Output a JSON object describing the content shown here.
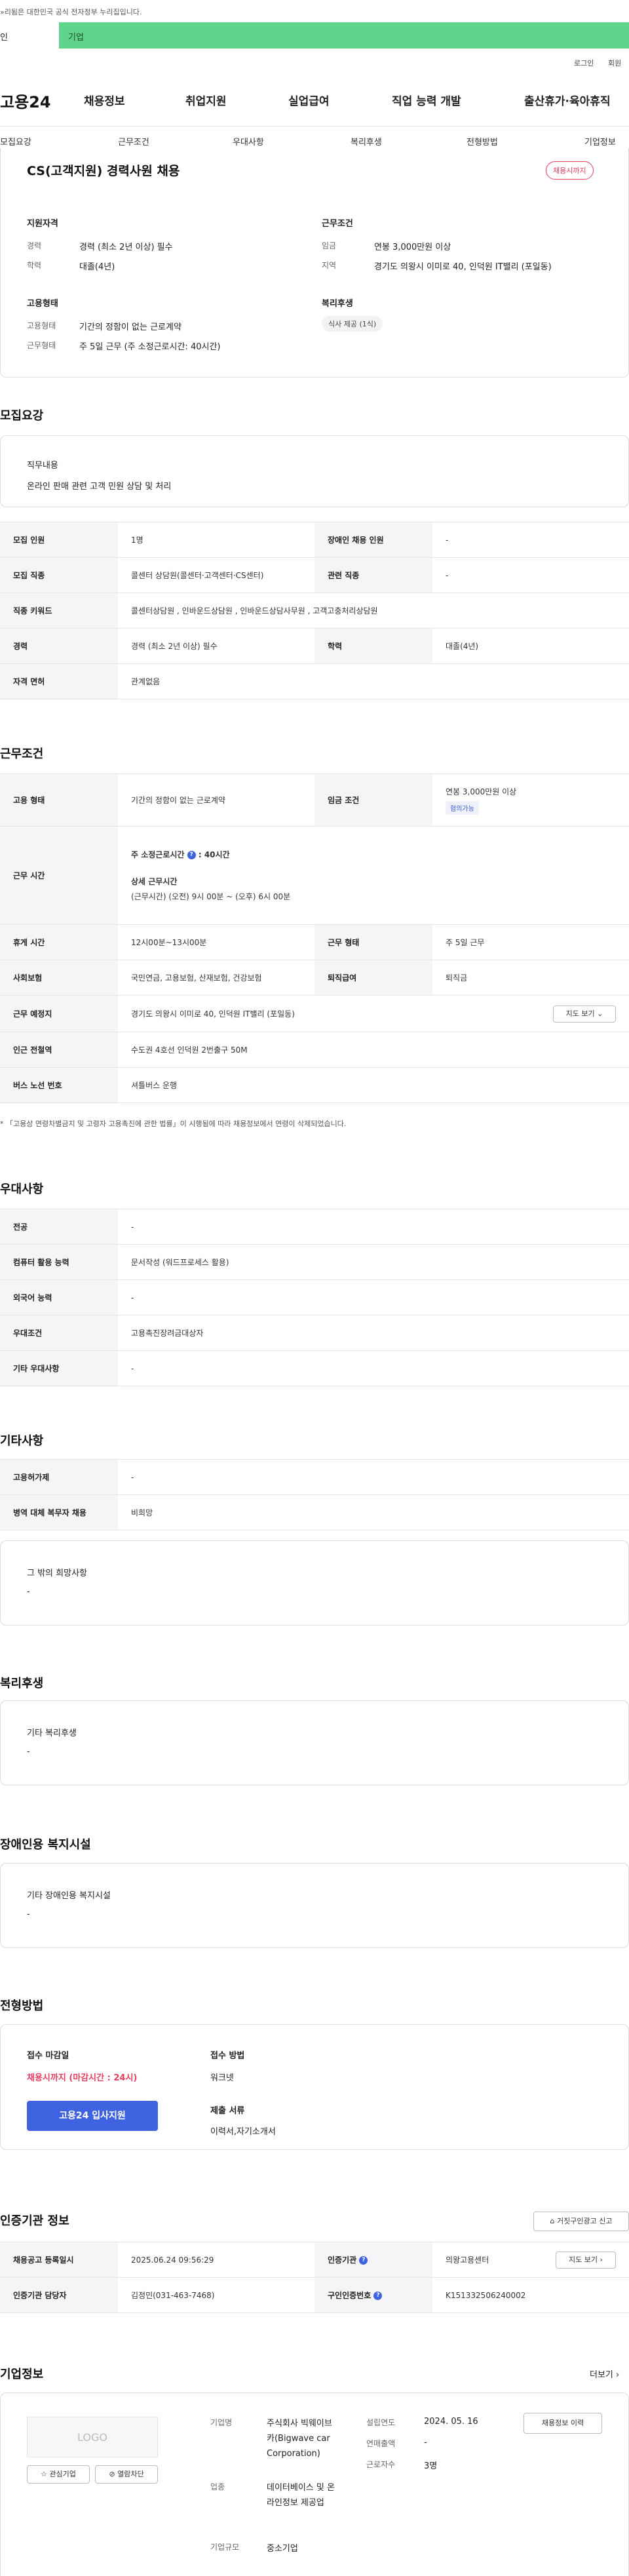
{
  "top_note": "»리됨은 대한민국 공식 전자정부 누리집입니다.",
  "top_tabs": {
    "left": "인",
    "right": "기업"
  },
  "util": {
    "login": "로그인",
    "join": "회원"
  },
  "gnb": {
    "logo": "고용24",
    "items": [
      "채용정보",
      "취업지원",
      "실업급여",
      "직업 능력 개발",
      "출산휴가·육아휴직"
    ]
  },
  "lnb": [
    "모집요강",
    "근무조건",
    "우대사항",
    "복리후생",
    "전형방법",
    "기업정보"
  ],
  "summary": {
    "title": "CS(고객지원) 경력사원 채용",
    "badge": "채용시까지",
    "qual": {
      "heading": "지원자격",
      "career_label": "경력",
      "career_value": "경력 (최소 2년 이상) 필수",
      "edu_label": "학력",
      "edu_value": "대졸(4년)"
    },
    "emp": {
      "heading": "고용형태",
      "type_label": "고용형태",
      "type_value": "기간의 정함이 없는 근로계약",
      "form_label": "근무형태",
      "form_value": "주 5일 근무 (주 소정근로시간: 40시간)"
    },
    "cond": {
      "heading": "근무조건",
      "wage_label": "임금",
      "wage_value": "연봉 3,000만원 이상",
      "loc_label": "지역",
      "loc_value": "경기도 의왕시 이미로 40, 인덕원 IT밸리 (포일동)"
    },
    "welfare": {
      "heading": "복리후생",
      "chip": "식사 제공 (1식)"
    }
  },
  "recruit": {
    "title": "모집요강",
    "duty_label": "직무내용",
    "duty_value": "온라인 판매 관련 고객 민원 상담 및 처리",
    "rows": {
      "count_label": "모집 인원",
      "count_value": "1명",
      "dis_label": "장애인 채용 인원",
      "dis_value": "-",
      "job_label": "모집 직종",
      "job_value": "콜센터 상담원(콜센터·고객센터·CS센터)",
      "rel_label": "관련 직종",
      "rel_value": "-",
      "kw_label": "직종 키워드",
      "kw_value": "콜센터상담원 , 인바운드상담원 , 인바운드상담사무원 , 고객고충처리상담원",
      "car_label": "경력",
      "car_value": "경력 (최소 2년 이상) 필수",
      "edu_label": "학력",
      "edu_value": "대졸(4년)",
      "lic_label": "자격 면허",
      "lic_value": "관계없음"
    }
  },
  "work": {
    "title": "근무조건",
    "type_label": "고용 형태",
    "type_value": "기간의 정함이 없는 근로계약",
    "wage_label": "임금 조건",
    "wage_value": "연봉 3,000만원 이상",
    "wage_chip": "협의가능",
    "hours_label": "근무 시간",
    "hours_week": "주 소정근로시간",
    "hours_week_value": "40시간",
    "hours_detail_label": "상세 근무시간",
    "hours_detail": "(근무시간) (오전) 9시 00분 ~ (오후) 6시 00분",
    "rest_label": "휴게 시간",
    "rest_value": "12시00분~13시00분",
    "form_label": "근무 형태",
    "form_value": "주 5일 근무",
    "ins_label": "사회보험",
    "ins_value": "국민연금, 고용보험, 산재보험, 건강보험",
    "ret_label": "퇴직급여",
    "ret_value": "퇴직금",
    "place_label": "근무 예정지",
    "place_value": "경기도 의왕시 이미로 40, 인덕원 IT밸리 (포일동)",
    "map_btn": "지도 보기",
    "sub_label": "인근 전철역",
    "sub_value": "수도권 4호선 인덕원 2번출구 50M",
    "bus_label": "버스 노선 번호",
    "bus_value": "셔틀버스 운행",
    "note": "* 「고용상 연령차별금지 및 고령자 고용촉진에 관한 법률」이 시행됨에 따라 채용정보에서 연령이 삭제되었습니다."
  },
  "pref": {
    "title": "우대사항",
    "major_label": "전공",
    "major_value": "-",
    "comp_label": "컴퓨터 활용 능력",
    "comp_value": "문서작성 (워드프로세스 활용)",
    "lang_label": "외국어 능력",
    "lang_value": "-",
    "cond_label": "우대조건",
    "cond_value": "고용촉진장려금대상자",
    "etc_label": "기타 우대사항",
    "etc_value": "-"
  },
  "other": {
    "title": "기타사항",
    "hire_label": "고용허가제",
    "hire_value": "-",
    "mil_label": "병역 대체 복무자 채용",
    "mil_value": "비희망",
    "wish_label": "그 밖의 희망사항",
    "wish_value": "-"
  },
  "welfare": {
    "title": "복리후생",
    "label": "기타 복리후생",
    "value": "-"
  },
  "disabled": {
    "title": "장애인용 복지시설",
    "label": "기타 장애인용 복지시설",
    "value": "-"
  },
  "process": {
    "title": "전형방법",
    "deadline_label": "접수 마감일",
    "deadline_value": "채용시까지 (마감시간 : 24시)",
    "apply_btn": "고용24 입사지원",
    "method_label": "접수 방법",
    "method_value": "워크넷",
    "docs_label": "제출 서류",
    "docs_value": "이력서,자기소개서"
  },
  "cert": {
    "title": "인증기관 정보",
    "report_btn": "거짓구인광고 신고",
    "reg_label": "채용공고 등록일시",
    "reg_value": "2025.06.24 09:56:29",
    "org_label": "인증기관",
    "org_value": "의왕고용센터",
    "map_btn": "지도 보기",
    "mgr_label": "인증기관 담당자",
    "mgr_value": "김정민(031-463-7468)",
    "num_label": "구인인증번호",
    "num_value": "K151332506240002"
  },
  "company": {
    "title": "기업정보",
    "more": "더보기",
    "logo": "LOGO",
    "fav_btn": "관심기업",
    "hide_btn": "열람차단",
    "name_label": "기업명",
    "name_value": "주식회사 빅웨이브카(Bigwave car Corporation)",
    "ind_label": "업종",
    "ind_value": "데이터베이스 및 온라인정보 제공업",
    "size_label": "기업규모",
    "size_value": "중소기업",
    "est_label": "설립연도",
    "est_value": "2024. 05. 16",
    "sales_label": "연매출액",
    "sales_value": "-",
    "emp_label": "근로자수",
    "emp_value": "3명",
    "history_btn": "채용정보 이력"
  }
}
